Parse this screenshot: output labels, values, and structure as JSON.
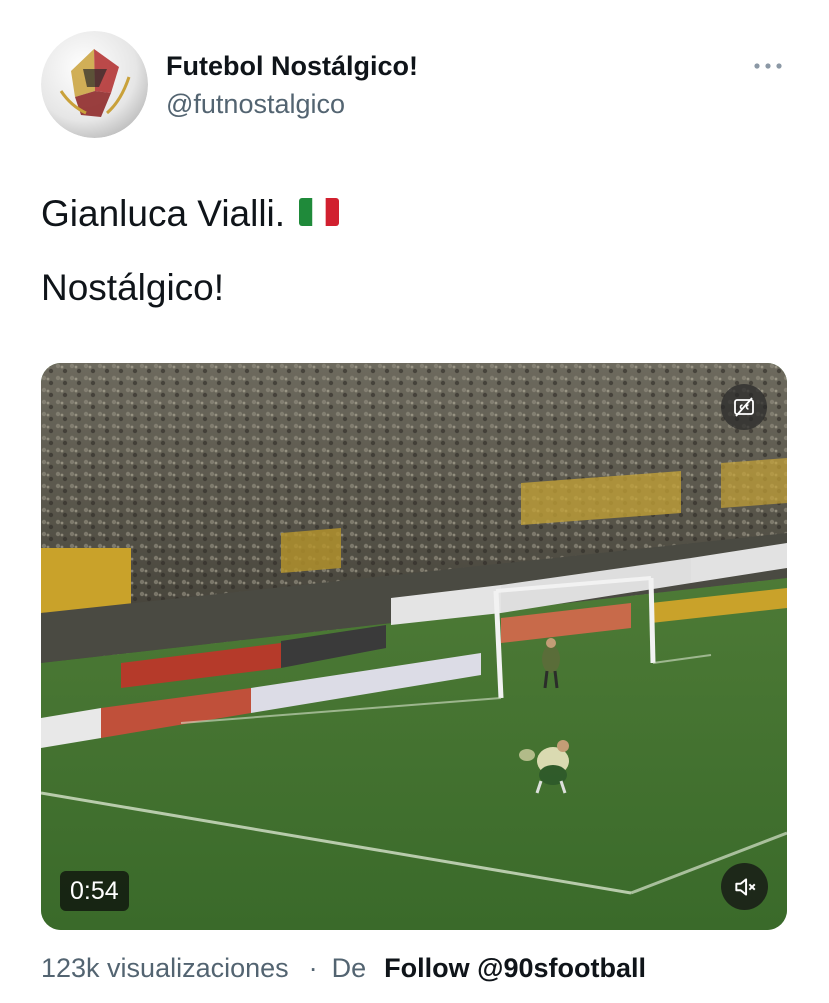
{
  "author": {
    "display_name": "Futebol Nostálgico!",
    "handle": "@futnostalgico",
    "avatar_icon": "soccer-ball-avatar"
  },
  "more_icon": "more-horizontal-icon",
  "tweet": {
    "line1": "Gianluca Vialli.",
    "line1_emoji": "italy-flag",
    "line2": "Nostálgico!"
  },
  "media": {
    "type": "video",
    "duration": "0:54",
    "captions_icon": "closed-captions-off-icon",
    "mute_icon": "volume-muted-icon"
  },
  "footer": {
    "views": "123k visualizaciones",
    "separator": "·",
    "from_label": "De",
    "source_link": "Follow @90sfootball"
  },
  "colors": {
    "primary_text": "#0f1419",
    "secondary_text": "#536471",
    "pitch_green": "#3f6b2e"
  }
}
